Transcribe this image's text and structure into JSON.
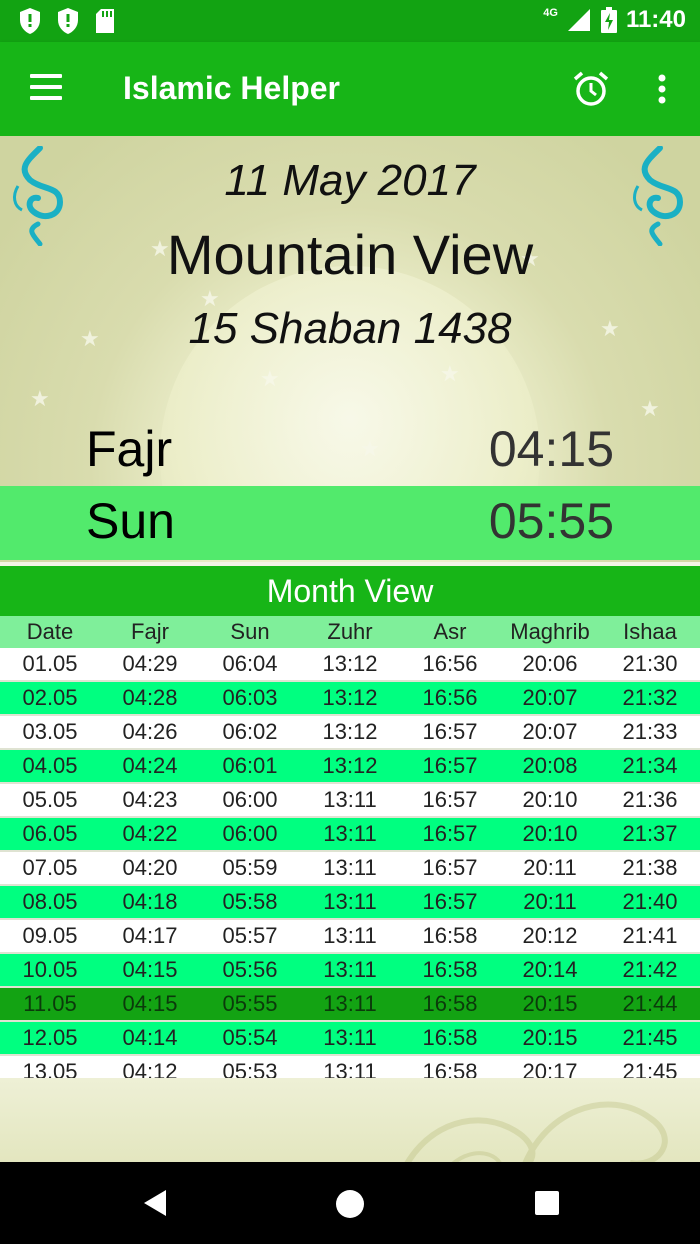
{
  "status_bar": {
    "time": "11:40",
    "network": "4G",
    "icons": [
      "shield-icon",
      "shield-icon",
      "sd-card-icon",
      "signal-icon",
      "battery-charging-icon"
    ]
  },
  "app_bar": {
    "title": "Islamic Helper",
    "menu_icon": "hamburger-menu-icon",
    "alarm_icon": "alarm-clock-icon",
    "more_icon": "overflow-menu-icon"
  },
  "header": {
    "gregorian_date": "11 May 2017",
    "city": "Mountain View",
    "hijri_date": "15 Shaban 1438",
    "prayers": [
      {
        "name": "Fajr",
        "time": "04:15"
      },
      {
        "name": "Sun",
        "time": "05:55"
      }
    ]
  },
  "month_view": {
    "title": "Month View",
    "columns": [
      "Date",
      "Fajr",
      "Sun",
      "Zuhr",
      "Asr",
      "Maghrib",
      "Ishaa"
    ],
    "rows": [
      [
        "01.05",
        "04:29",
        "06:04",
        "13:12",
        "16:56",
        "20:06",
        "21:30"
      ],
      [
        "02.05",
        "04:28",
        "06:03",
        "13:12",
        "16:56",
        "20:07",
        "21:32"
      ],
      [
        "03.05",
        "04:26",
        "06:02",
        "13:12",
        "16:57",
        "20:07",
        "21:33"
      ],
      [
        "04.05",
        "04:24",
        "06:01",
        "13:12",
        "16:57",
        "20:08",
        "21:34"
      ],
      [
        "05.05",
        "04:23",
        "06:00",
        "13:11",
        "16:57",
        "20:10",
        "21:36"
      ],
      [
        "06.05",
        "04:22",
        "06:00",
        "13:11",
        "16:57",
        "20:10",
        "21:37"
      ],
      [
        "07.05",
        "04:20",
        "05:59",
        "13:11",
        "16:57",
        "20:11",
        "21:38"
      ],
      [
        "08.05",
        "04:18",
        "05:58",
        "13:11",
        "16:57",
        "20:11",
        "21:40"
      ],
      [
        "09.05",
        "04:17",
        "05:57",
        "13:11",
        "16:58",
        "20:12",
        "21:41"
      ],
      [
        "10.05",
        "04:15",
        "05:56",
        "13:11",
        "16:58",
        "20:14",
        "21:42"
      ],
      [
        "11.05",
        "04:15",
        "05:55",
        "13:11",
        "16:58",
        "20:15",
        "21:44"
      ],
      [
        "12.05",
        "04:14",
        "05:54",
        "13:11",
        "16:58",
        "20:15",
        "21:45"
      ],
      [
        "13.05",
        "04:12",
        "05:53",
        "13:11",
        "16:58",
        "20:17",
        "21:45"
      ]
    ],
    "current_row_index": 10
  },
  "colors": {
    "status_bar": "#12a312",
    "app_bar": "#17b517",
    "row_highlight": "#00ff80",
    "current_row": "#13a313",
    "sun_row": "#52ea6c"
  },
  "nav_bar": {
    "icons": [
      "back-icon",
      "home-icon",
      "recent-apps-icon"
    ]
  }
}
